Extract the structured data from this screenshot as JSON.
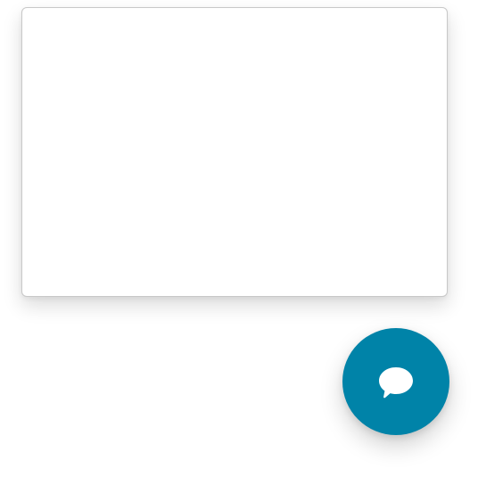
{
  "chat_panel": {
    "content": ""
  },
  "launcher": {
    "icon": "chat-bubble-icon",
    "background_color": "#0083a8",
    "icon_color": "#ffffff"
  },
  "page": {
    "background_color": "#ffffff"
  }
}
